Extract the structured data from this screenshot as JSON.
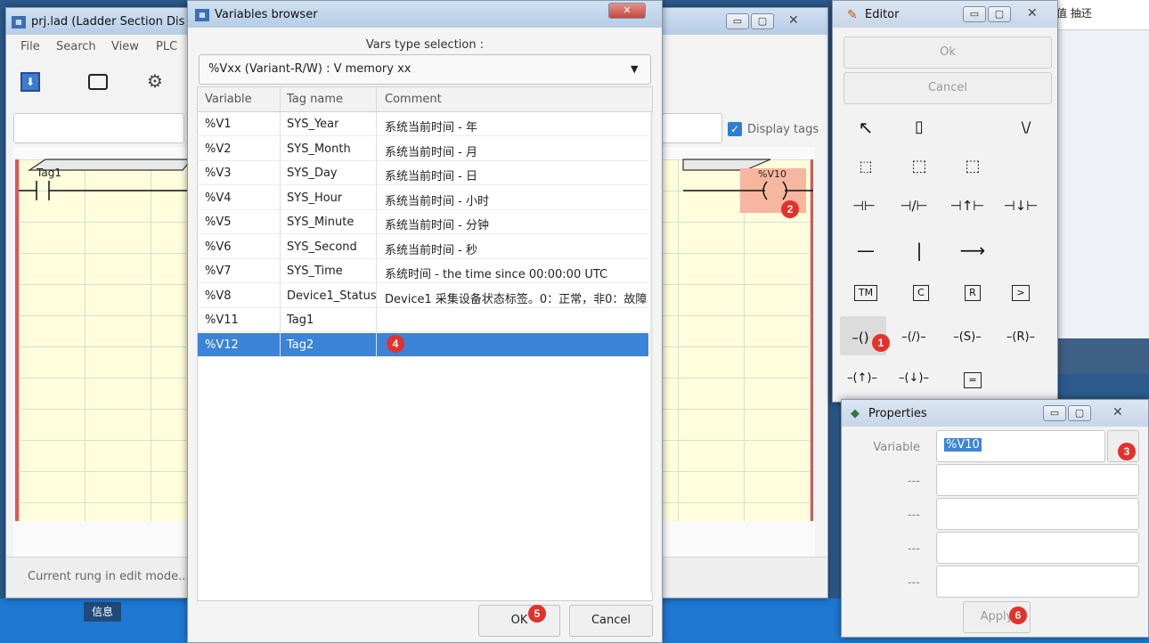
{
  "main_window": {
    "title": "prj.lad (Ladder Section Dis",
    "menu": [
      "File",
      "Search",
      "View",
      "PLC"
    ],
    "display_tags_label": "Display tags",
    "rung_tag_label": "Tag1",
    "coil_label": "%V10",
    "status_text": "Current rung in edit mode..."
  },
  "background": {
    "header_text": "值 抽还",
    "taskbar_label": "信息"
  },
  "vars_browser": {
    "title": "Variables browser",
    "type_selection_label": "Vars type selection :",
    "type_selected": "%Vxx (Variant-R/W) : V memory xx",
    "columns": [
      "Variable",
      "Tag name",
      "Comment"
    ],
    "rows": [
      {
        "variable": "%V1",
        "tag": "SYS_Year",
        "comment": "系统当前时间 - 年"
      },
      {
        "variable": "%V2",
        "tag": "SYS_Month",
        "comment": "系统当前时间 - 月"
      },
      {
        "variable": "%V3",
        "tag": "SYS_Day",
        "comment": "系统当前时间 - 日"
      },
      {
        "variable": "%V4",
        "tag": "SYS_Hour",
        "comment": "系统当前时间 - 小时"
      },
      {
        "variable": "%V5",
        "tag": "SYS_Minute",
        "comment": "系统当前时间 - 分钟"
      },
      {
        "variable": "%V6",
        "tag": "SYS_Second",
        "comment": "系统当前时间 - 秒"
      },
      {
        "variable": "%V7",
        "tag": "SYS_Time",
        "comment": "系统时间 - the time since 00:00:00 UTC"
      },
      {
        "variable": "%V8",
        "tag": "Device1_Status",
        "comment": "Device1 采集设备状态标签。0：正常，非0：故障"
      },
      {
        "variable": "%V11",
        "tag": "Tag1",
        "comment": ""
      },
      {
        "variable": "%V12",
        "tag": "Tag2",
        "comment": ""
      }
    ],
    "selected_row": 9,
    "ok_label": "OK",
    "cancel_label": "Cancel"
  },
  "editor": {
    "title": "Editor",
    "ok_label": "Ok",
    "cancel_label": "Cancel",
    "tools_row1": [
      "↖",
      "▯",
      "\\/"
    ],
    "tools_row2": [
      "⬚",
      "⬚",
      "⬚"
    ],
    "tools_row3": [
      "⊣⊢",
      "⊣/⊢",
      "⊣↑⊢",
      "⊣↓⊢"
    ],
    "tools_row4": [
      "—",
      "|",
      "⟶"
    ],
    "tools_row5": [
      "TM",
      "C",
      "R",
      ">"
    ],
    "tools_row6": [
      "–()",
      "–(/)–",
      "–(S)–",
      "–(R)–"
    ],
    "tools_row7": [
      "–(↑)–",
      "–(↓)–",
      "="
    ]
  },
  "properties": {
    "title": "Properties",
    "variable_label": "Variable",
    "variable_value": "%V10",
    "other_labels": [
      "---",
      "---",
      "---",
      "---"
    ],
    "apply_label": "Apply"
  },
  "markers": [
    "1",
    "2",
    "3",
    "4",
    "5",
    "6"
  ],
  "colors": {
    "selection": "#3b84d8",
    "ladder_bg": "#fffddb",
    "marker": "#e2322b",
    "check": "#2d7fd5"
  }
}
